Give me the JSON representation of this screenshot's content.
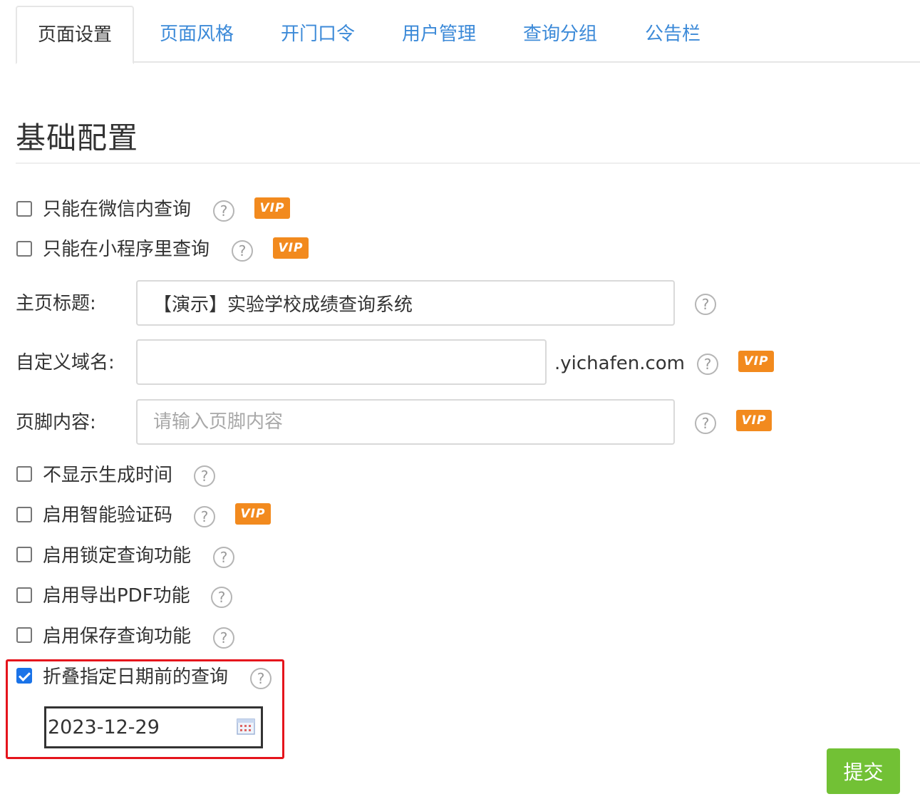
{
  "tabs": [
    {
      "label": "页面设置",
      "active": true
    },
    {
      "label": "页面风格",
      "active": false
    },
    {
      "label": "开门口令",
      "active": false
    },
    {
      "label": "用户管理",
      "active": false
    },
    {
      "label": "查询分组",
      "active": false
    },
    {
      "label": "公告栏",
      "active": false
    }
  ],
  "section": {
    "title": "基础配置"
  },
  "options": {
    "wechat_only": {
      "label": "只能在微信内查询",
      "checked": false,
      "vip": true
    },
    "miniprogram_only": {
      "label": "只能在小程序里查询",
      "checked": false,
      "vip": true
    },
    "hide_generate_time": {
      "label": "不显示生成时间",
      "checked": false,
      "vip": false
    },
    "smart_captcha": {
      "label": "启用智能验证码",
      "checked": false,
      "vip": true
    },
    "lock_query": {
      "label": "启用锁定查询功能",
      "checked": false,
      "vip": false
    },
    "export_pdf": {
      "label": "启用导出PDF功能",
      "checked": false,
      "vip": false
    },
    "save_query": {
      "label": "启用保存查询功能",
      "checked": false,
      "vip": false
    },
    "fold_before_date": {
      "label": "折叠指定日期前的查询",
      "checked": true,
      "vip": false
    }
  },
  "fields": {
    "home_title": {
      "label": "主页标题:",
      "value": "【演示】实验学校成绩查询系统"
    },
    "custom_domain": {
      "label": "自定义域名:",
      "value": "",
      "suffix": ".yichafen.com",
      "vip": true
    },
    "footer": {
      "label": "页脚内容:",
      "value": "",
      "placeholder": "请输入页脚内容",
      "vip": true
    }
  },
  "fold_date": {
    "value": "2023-12-29"
  },
  "badges": {
    "vip": "VIP",
    "help": "?"
  },
  "submit_label": "提交",
  "colors": {
    "link": "#3c8ad8",
    "vip": "#f28a1e",
    "submit": "#72c135",
    "highlight": "#e5141c",
    "checkbox_checked": "#1a73e8"
  }
}
